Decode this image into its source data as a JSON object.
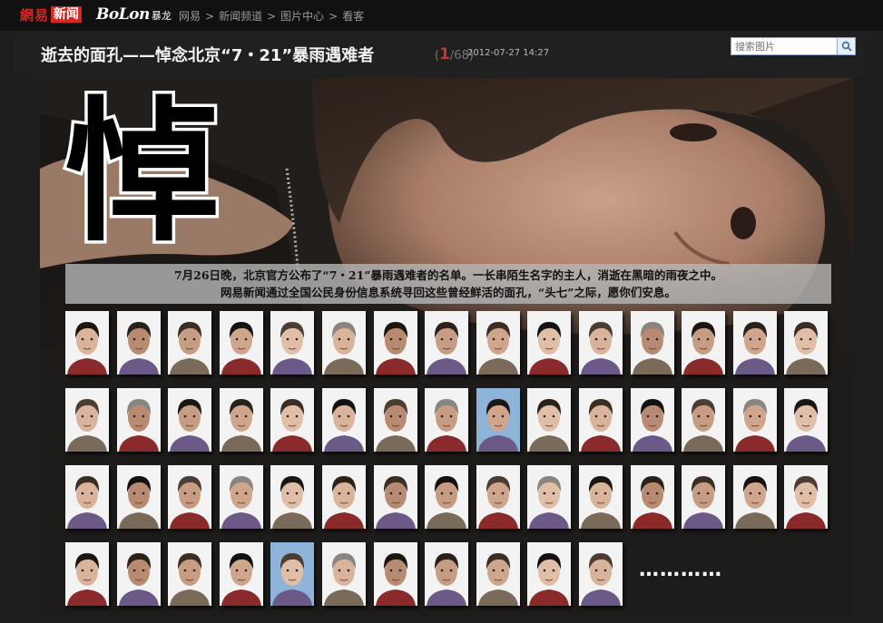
{
  "topbar": {
    "logo_163_a": "網易",
    "logo_163_b": "新闻",
    "bolon_en": "BoLon",
    "bolon_cn": "暴龙",
    "breadcrumb": [
      "网易",
      "新闻频道",
      "图片中心",
      "看客"
    ],
    "separator": ">"
  },
  "header": {
    "title": "逝去的面孔——悼念北京“7・21”暴雨遇难者",
    "counter_open": "(",
    "counter_current": "1",
    "counter_total": "/68)",
    "date": "2012-07-27 14:27",
    "search_placeholder": "搜索图片"
  },
  "hero": {
    "mourn_char": "悼",
    "caption_line1": "7月26日晚，北京官方公布了“7・21”暴雨遇难者的名单。一长串陌生名字的主人，消逝在黑暗的雨夜之中。",
    "caption_line2": "网易新闻通过全国公民身份信息系统寻回这些曾经鲜活的面孔，“头七”之际，愿你们安息。",
    "ellipsis": "…………",
    "portrait_rows": [
      15,
      15,
      15,
      11
    ]
  },
  "colors": {
    "brand_red": "#d6261f",
    "counter_red": "#c0392b",
    "page_bg": "#1e1e1e"
  }
}
